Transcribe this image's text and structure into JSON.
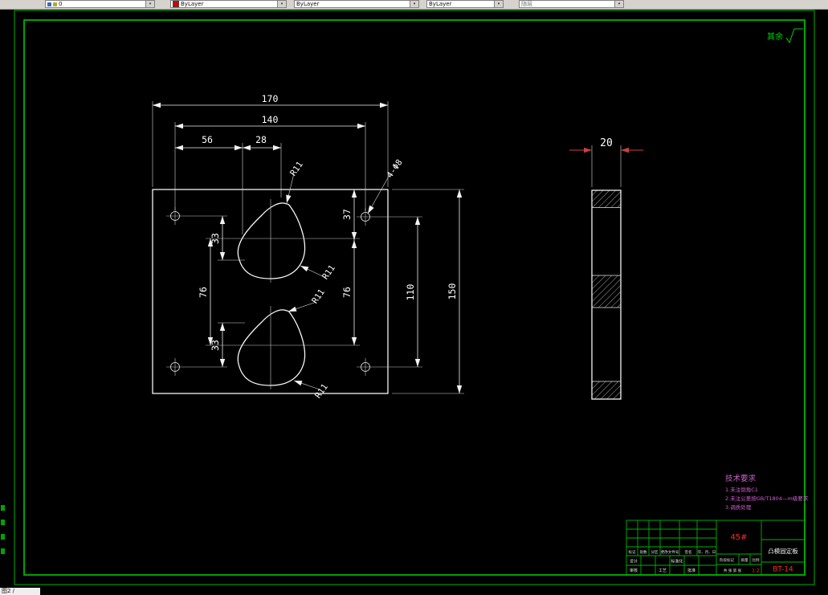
{
  "toolbar": {
    "layer_value": "0",
    "color_value": "ByLayer",
    "linetype_value": "ByLayer",
    "lineweight_value": "ByLayer",
    "plotstyle_value": "随层",
    "dropdown_glyph": "▾"
  },
  "drawing": {
    "surface_note": "其余",
    "dims": {
      "width_outer": "170",
      "width_holes": "140",
      "offset_56": "56",
      "offset_28": "28",
      "left_33_upper": "33",
      "left_76": "76",
      "left_33_lower": "33",
      "right_37": "37",
      "right_76": "76",
      "right_110": "110",
      "right_150": "150",
      "thickness": "20"
    },
    "callouts": {
      "r_top": "R11",
      "r_mid_upper": "R11",
      "r_mid_lower": "R11",
      "r_bottom": "R11",
      "holes": "4-Φ8"
    }
  },
  "tech_req": {
    "title": "技术要求",
    "items": [
      "1.未注倒角C1",
      "2.未注公差按GB/T1804—m级要求",
      "3.调质处理"
    ]
  },
  "title_block": {
    "material": "45#",
    "part_name": "凸模固定板",
    "drawing_no": "BT-14",
    "scale": "1:2",
    "sheet": "共 张 第 张",
    "rev_row": [
      "标记",
      "处数",
      "分区",
      "更改文件号",
      "签名",
      "年、月、日"
    ],
    "sign_labels": [
      "设计",
      "标准化",
      "审核",
      "工艺",
      "批准"
    ],
    "stage_labels": [
      "阶段标记",
      "质量",
      "比例"
    ]
  },
  "statusbar": {
    "text": "图2 /"
  }
}
